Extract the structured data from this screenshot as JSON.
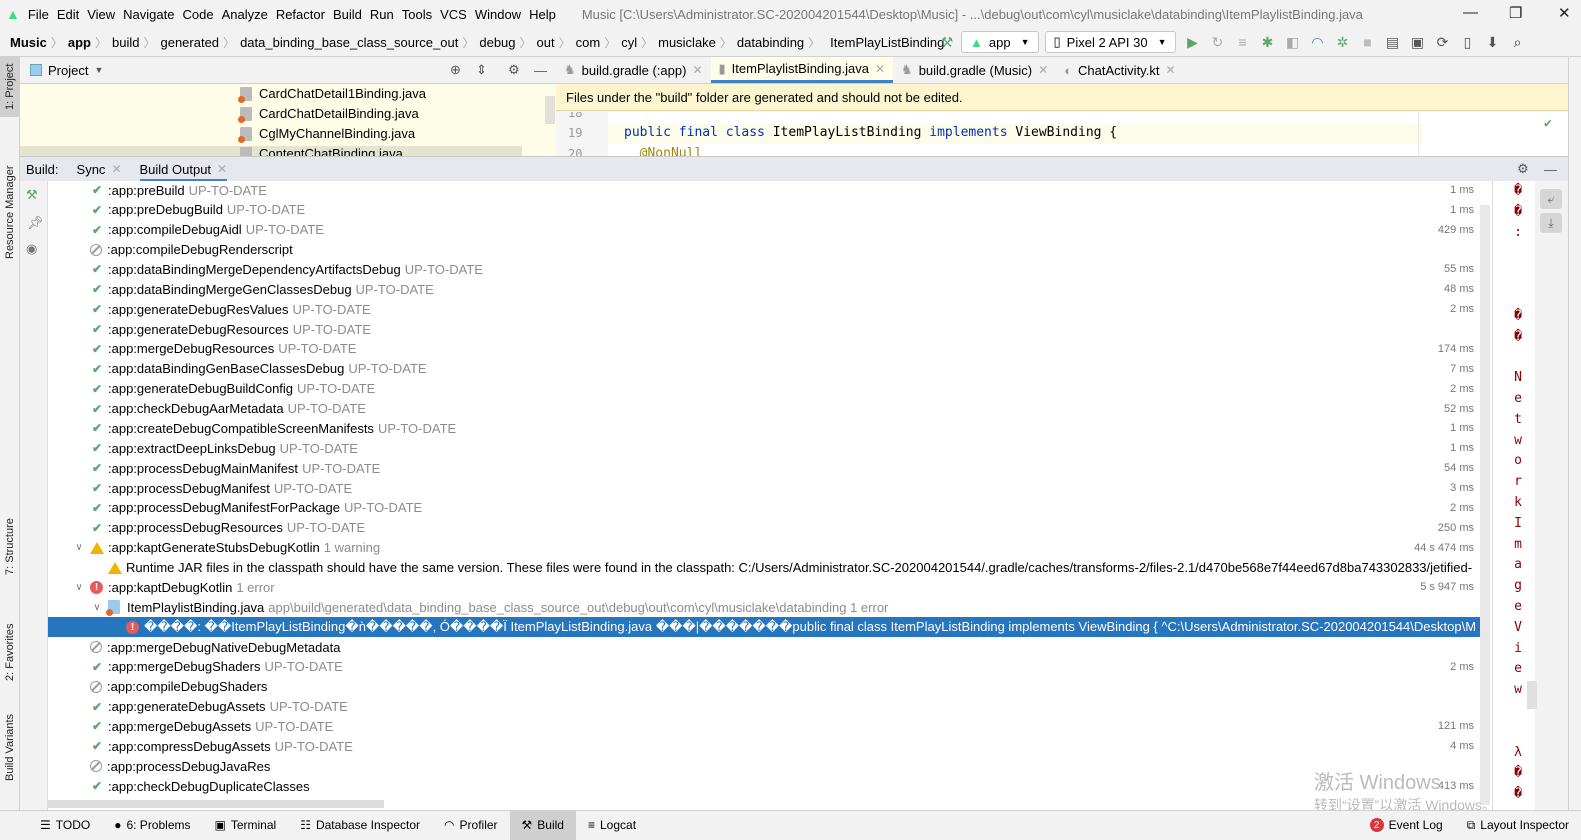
{
  "menu": [
    "File",
    "Edit",
    "View",
    "Navigate",
    "Code",
    "Analyze",
    "Refactor",
    "Build",
    "Run",
    "Tools",
    "VCS",
    "Window",
    "Help"
  ],
  "window_title": "Music [C:\\Users\\Administrator.SC-202004201544\\Desktop\\Music] - ...\\debug\\out\\com\\cyl\\musiclake\\databinding\\ItemPlaylistBinding.java",
  "breadcrumbs": [
    "Music",
    "app",
    "build",
    "generated",
    "data_binding_base_class_source_out",
    "debug",
    "out",
    "com",
    "cyl",
    "musiclake",
    "databinding",
    "ItemPlayListBinding"
  ],
  "run_config": "app",
  "device": "Pixel 2 API 30",
  "left_tabs": [
    "1: Project",
    "Resource Manager",
    "7: Structure",
    "2: Favorites",
    "Build Variants"
  ],
  "project": {
    "title": "Project",
    "files": [
      "CardChatDetail1Binding.java",
      "CardChatDetailBinding.java",
      "CglMyChannelBinding.java",
      "ContentChatBinding.java"
    ]
  },
  "editor": {
    "tabs": [
      "build.gradle (:app)",
      "ItemPlaylistBinding.java",
      "build.gradle (Music)",
      "ChatActivity.kt"
    ],
    "active_tab": 1,
    "banner": "Files under the \"build\" folder are generated and should not be edited.",
    "lines": [
      {
        "no": "18",
        "code": ""
      },
      {
        "no": "19",
        "kw1": "public final class",
        "name": " ItemPlayListBinding ",
        "kw2": "implements",
        "rest": " ViewBinding {"
      },
      {
        "no": "20",
        "code": "  @NonNull"
      }
    ]
  },
  "build": {
    "label": "Build:",
    "tabs": [
      "Sync",
      "Build Output"
    ],
    "rows": [
      {
        "s": "ok",
        "n": ":app:preBuild",
        "x": "UP-TO-DATE",
        "t": "1 ms"
      },
      {
        "s": "ok",
        "n": ":app:preDebugBuild",
        "x": "UP-TO-DATE",
        "t": "1 ms"
      },
      {
        "s": "ok",
        "n": ":app:compileDebugAidl",
        "x": "UP-TO-DATE",
        "t": "429 ms"
      },
      {
        "s": "skip",
        "n": ":app:compileDebugRenderscript",
        "x": "",
        "t": ""
      },
      {
        "s": "ok",
        "n": ":app:dataBindingMergeDependencyArtifactsDebug",
        "x": "UP-TO-DATE",
        "t": "55 ms"
      },
      {
        "s": "ok",
        "n": ":app:dataBindingMergeGenClassesDebug",
        "x": "UP-TO-DATE",
        "t": "48 ms"
      },
      {
        "s": "ok",
        "n": ":app:generateDebugResValues",
        "x": "UP-TO-DATE",
        "t": "2 ms"
      },
      {
        "s": "ok",
        "n": ":app:generateDebugResources",
        "x": "UP-TO-DATE",
        "t": ""
      },
      {
        "s": "ok",
        "n": ":app:mergeDebugResources",
        "x": "UP-TO-DATE",
        "t": "174 ms"
      },
      {
        "s": "ok",
        "n": ":app:dataBindingGenBaseClassesDebug",
        "x": "UP-TO-DATE",
        "t": "7 ms"
      },
      {
        "s": "ok",
        "n": ":app:generateDebugBuildConfig",
        "x": "UP-TO-DATE",
        "t": "2 ms"
      },
      {
        "s": "ok",
        "n": ":app:checkDebugAarMetadata",
        "x": "UP-TO-DATE",
        "t": "52 ms"
      },
      {
        "s": "ok",
        "n": ":app:createDebugCompatibleScreenManifests",
        "x": "UP-TO-DATE",
        "t": "1 ms"
      },
      {
        "s": "ok",
        "n": ":app:extractDeepLinksDebug",
        "x": "UP-TO-DATE",
        "t": "1 ms"
      },
      {
        "s": "ok",
        "n": ":app:processDebugMainManifest",
        "x": "UP-TO-DATE",
        "t": "54 ms"
      },
      {
        "s": "ok",
        "n": ":app:processDebugManifest",
        "x": "UP-TO-DATE",
        "t": "3 ms"
      },
      {
        "s": "ok",
        "n": ":app:processDebugManifestForPackage",
        "x": "UP-TO-DATE",
        "t": "2 ms"
      },
      {
        "s": "ok",
        "n": ":app:processDebugResources",
        "x": "UP-TO-DATE",
        "t": "250 ms"
      },
      {
        "s": "warn",
        "n": ":app:kaptGenerateStubsDebugKotlin",
        "x": "1 warning",
        "t": "44 s 474 ms",
        "exp": true
      },
      {
        "s": "warn",
        "n": "Runtime JAR files in the classpath should have the same version. These files were found in the classpath:     C:/Users/Administrator.SC-202004201544/.gradle/caches/transforms-2/files-2.1/d470be568e7f44eed67d8ba743302833/jetified-",
        "x": "",
        "t": "",
        "lvl": 1
      },
      {
        "s": "err",
        "n": ":app:kaptDebugKotlin",
        "x": "1 error",
        "t": "5 s 947 ms",
        "exp": true
      },
      {
        "s": "file",
        "n": "ItemPlaylistBinding.java",
        "x": "app\\build\\generated\\data_binding_base_class_source_out\\debug\\out\\com\\cyl\\musiclake\\databinding 1 error",
        "t": "",
        "exp": true,
        "lvl": 1
      },
      {
        "s": "err",
        "n": "����: ��ItemPlayListBinding�ǹ�����, Ó����Ï ItemPlayListBinding.java ���|�������public final class ItemPlayListBinding implements ViewBinding {            ^C:\\Users\\Administrator.SC-202004201544\\Desktop\\M",
        "x": "",
        "t": "",
        "lvl": 2,
        "sel": true
      },
      {
        "s": "skip",
        "n": ":app:mergeDebugNativeDebugMetadata",
        "x": "",
        "t": ""
      },
      {
        "s": "ok",
        "n": ":app:mergeDebugShaders",
        "x": "UP-TO-DATE",
        "t": "2 ms"
      },
      {
        "s": "skip",
        "n": ":app:compileDebugShaders",
        "x": "",
        "t": ""
      },
      {
        "s": "ok",
        "n": ":app:generateDebugAssets",
        "x": "UP-TO-DATE",
        "t": ""
      },
      {
        "s": "ok",
        "n": ":app:mergeDebugAssets",
        "x": "UP-TO-DATE",
        "t": "121 ms"
      },
      {
        "s": "ok",
        "n": ":app:compressDebugAssets",
        "x": "UP-TO-DATE",
        "t": "4 ms"
      },
      {
        "s": "skip",
        "n": ":app:processDebugJavaRes",
        "x": "",
        "t": ""
      },
      {
        "s": "ok",
        "n": ":app:checkDebugDuplicateClasses",
        "x": "",
        "t": "413 ms"
      }
    ]
  },
  "console_chars": [
    "�",
    "�",
    ":",
    "",
    "",
    "",
    "�",
    "�",
    "",
    "N",
    "e",
    "t",
    "w",
    "o",
    "r",
    "k",
    "I",
    "m",
    "a",
    "g",
    "e",
    "V",
    "i",
    "e",
    "w",
    "",
    "",
    "λ",
    "�",
    "�"
  ],
  "status_bar": {
    "items": [
      "TODO",
      "6: Problems",
      "Terminal",
      "Database Inspector",
      "Profiler",
      "Build",
      "Logcat"
    ],
    "event_log": "Event Log",
    "event_count": "2",
    "layout_inspector": "Layout Inspector"
  },
  "watermark": {
    "line1": "激活 Windows",
    "line2": "转到“设置”以激活 Windows。"
  },
  "colors": {
    "selection": "#2675bf",
    "success": "#59a869",
    "error": "#e55b5b",
    "warning": "#f2b300",
    "banner": "#fcf5cf"
  }
}
